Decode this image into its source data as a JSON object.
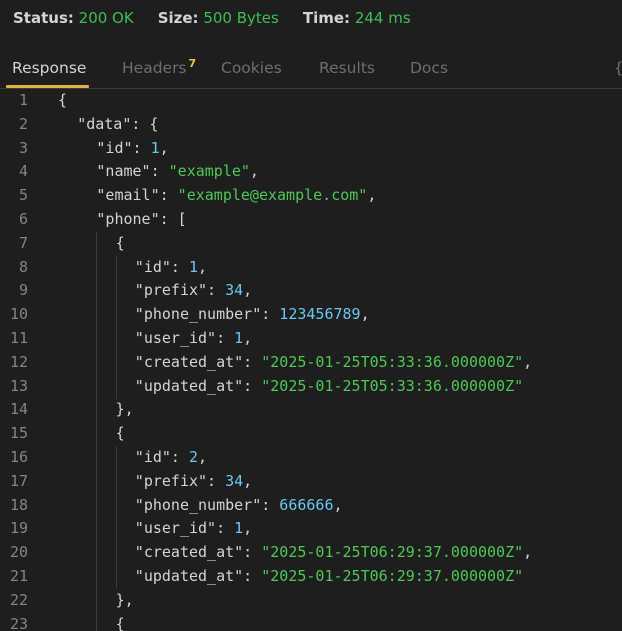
{
  "status": {
    "status_label": "Status:",
    "status_value": "200 OK",
    "size_label": "Size:",
    "size_value": "500 Bytes",
    "time_label": "Time:",
    "time_value": "244 ms"
  },
  "tabs": [
    {
      "label": "Response",
      "active": true
    },
    {
      "label": "Headers",
      "count": "7",
      "active": false
    },
    {
      "label": "Cookies",
      "active": false
    },
    {
      "label": "Results",
      "active": false
    },
    {
      "label": "Docs",
      "active": false
    }
  ],
  "tab_overflow": "{",
  "colors": {
    "accent": "#e3b341",
    "status_ok": "#3fbf52",
    "string": "#4ec957",
    "number": "#6cc7f2",
    "background": "#1e1e1e"
  },
  "code_lines": [
    {
      "n": "1",
      "indent": 0,
      "tokens": [
        [
          "p",
          "{"
        ]
      ]
    },
    {
      "n": "2",
      "indent": 1,
      "tokens": [
        [
          "k",
          "\"data\""
        ],
        [
          "p",
          ": {"
        ]
      ]
    },
    {
      "n": "3",
      "indent": 2,
      "tokens": [
        [
          "k",
          "\"id\""
        ],
        [
          "p",
          ": "
        ],
        [
          "n",
          "1"
        ],
        [
          "p",
          ","
        ]
      ]
    },
    {
      "n": "4",
      "indent": 2,
      "tokens": [
        [
          "k",
          "\"name\""
        ],
        [
          "p",
          ": "
        ],
        [
          "s",
          "\"example\""
        ],
        [
          "p",
          ","
        ]
      ]
    },
    {
      "n": "5",
      "indent": 2,
      "tokens": [
        [
          "k",
          "\"email\""
        ],
        [
          "p",
          ": "
        ],
        [
          "s",
          "\"example@example.com\""
        ],
        [
          "p",
          ","
        ]
      ]
    },
    {
      "n": "6",
      "indent": 2,
      "tokens": [
        [
          "k",
          "\"phone\""
        ],
        [
          "p",
          ": ["
        ]
      ]
    },
    {
      "n": "7",
      "indent": 3,
      "tokens": [
        [
          "p",
          "{"
        ]
      ]
    },
    {
      "n": "8",
      "indent": 4,
      "tokens": [
        [
          "k",
          "\"id\""
        ],
        [
          "p",
          ": "
        ],
        [
          "n",
          "1"
        ],
        [
          "p",
          ","
        ]
      ]
    },
    {
      "n": "9",
      "indent": 4,
      "tokens": [
        [
          "k",
          "\"prefix\""
        ],
        [
          "p",
          ": "
        ],
        [
          "n",
          "34"
        ],
        [
          "p",
          ","
        ]
      ]
    },
    {
      "n": "10",
      "indent": 4,
      "tokens": [
        [
          "k",
          "\"phone_number\""
        ],
        [
          "p",
          ": "
        ],
        [
          "n",
          "123456789"
        ],
        [
          "p",
          ","
        ]
      ]
    },
    {
      "n": "11",
      "indent": 4,
      "tokens": [
        [
          "k",
          "\"user_id\""
        ],
        [
          "p",
          ": "
        ],
        [
          "n",
          "1"
        ],
        [
          "p",
          ","
        ]
      ]
    },
    {
      "n": "12",
      "indent": 4,
      "tokens": [
        [
          "k",
          "\"created_at\""
        ],
        [
          "p",
          ": "
        ],
        [
          "s",
          "\"2025-01-25T05:33:36.000000Z\""
        ],
        [
          "p",
          ","
        ]
      ]
    },
    {
      "n": "13",
      "indent": 4,
      "tokens": [
        [
          "k",
          "\"updated_at\""
        ],
        [
          "p",
          ": "
        ],
        [
          "s",
          "\"2025-01-25T05:33:36.000000Z\""
        ]
      ]
    },
    {
      "n": "14",
      "indent": 3,
      "tokens": [
        [
          "p",
          "},"
        ]
      ]
    },
    {
      "n": "15",
      "indent": 3,
      "tokens": [
        [
          "p",
          "{"
        ]
      ]
    },
    {
      "n": "16",
      "indent": 4,
      "tokens": [
        [
          "k",
          "\"id\""
        ],
        [
          "p",
          ": "
        ],
        [
          "n",
          "2"
        ],
        [
          "p",
          ","
        ]
      ]
    },
    {
      "n": "17",
      "indent": 4,
      "tokens": [
        [
          "k",
          "\"prefix\""
        ],
        [
          "p",
          ": "
        ],
        [
          "n",
          "34"
        ],
        [
          "p",
          ","
        ]
      ]
    },
    {
      "n": "18",
      "indent": 4,
      "tokens": [
        [
          "k",
          "\"phone_number\""
        ],
        [
          "p",
          ": "
        ],
        [
          "n",
          "666666"
        ],
        [
          "p",
          ","
        ]
      ]
    },
    {
      "n": "19",
      "indent": 4,
      "tokens": [
        [
          "k",
          "\"user_id\""
        ],
        [
          "p",
          ": "
        ],
        [
          "n",
          "1"
        ],
        [
          "p",
          ","
        ]
      ]
    },
    {
      "n": "20",
      "indent": 4,
      "tokens": [
        [
          "k",
          "\"created_at\""
        ],
        [
          "p",
          ": "
        ],
        [
          "s",
          "\"2025-01-25T06:29:37.000000Z\""
        ],
        [
          "p",
          ","
        ]
      ]
    },
    {
      "n": "21",
      "indent": 4,
      "tokens": [
        [
          "k",
          "\"updated_at\""
        ],
        [
          "p",
          ": "
        ],
        [
          "s",
          "\"2025-01-25T06:29:37.000000Z\""
        ]
      ]
    },
    {
      "n": "22",
      "indent": 3,
      "tokens": [
        [
          "p",
          "},"
        ]
      ]
    },
    {
      "n": "23",
      "indent": 3,
      "tokens": [
        [
          "p",
          "{"
        ]
      ]
    }
  ]
}
